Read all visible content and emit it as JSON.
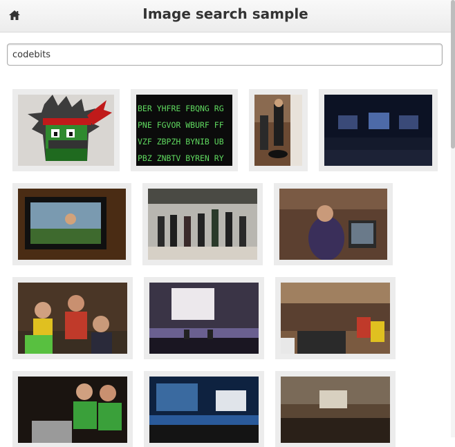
{
  "header": {
    "title": "Image search sample",
    "home_icon": "home-icon"
  },
  "search": {
    "value": "codebits"
  },
  "results": [
    {
      "name": "ninja-mascot-illustration",
      "text_lines": []
    },
    {
      "name": "cipher-text-green-on-black",
      "text_lines": [
        "BER YHFRE FBQNG RG",
        "PNE FGVOR WBURF FF",
        "VZF ZBPZH BYNIB UB",
        "PBZ ZNBTV BYREN RY"
      ]
    },
    {
      "name": "people-on-segways",
      "text_lines": []
    },
    {
      "name": "dark-conference-hall-stage",
      "text_lines": []
    },
    {
      "name": "monitor-screen-presenter",
      "text_lines": []
    },
    {
      "name": "group-on-stage-codebits",
      "text_lines": []
    },
    {
      "name": "man-at-laptop",
      "text_lines": []
    },
    {
      "name": "audience-with-lanyards",
      "text_lines": []
    },
    {
      "name": "stage-with-projector-screen",
      "text_lines": []
    },
    {
      "name": "crowd-at-hackathon",
      "text_lines": []
    },
    {
      "name": "people-in-green-shirts-laptops",
      "text_lines": []
    },
    {
      "name": "stage-blue-lights-crowd",
      "text_lines": []
    },
    {
      "name": "large-hall-attendees",
      "text_lines": []
    }
  ]
}
